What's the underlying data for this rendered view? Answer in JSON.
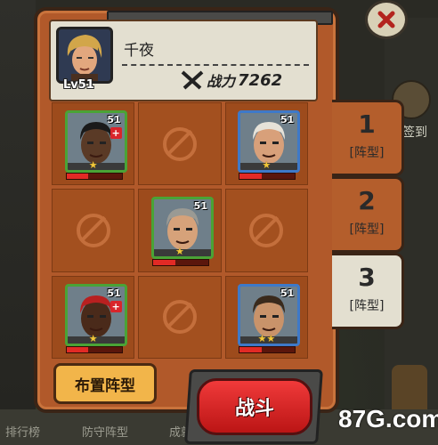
{
  "player": {
    "name": "千夜",
    "level": "Lv51",
    "power_label": "战力",
    "power_value": "7262"
  },
  "grid": [
    {
      "slot": 1,
      "hero": {
        "level": "51",
        "frame": "green",
        "stars": "★",
        "medic": true,
        "skin": "#5a3a26",
        "hair": "#1a1a1a",
        "hp": 0.4
      }
    },
    {
      "slot": 2,
      "hero": null
    },
    {
      "slot": 3,
      "hero": {
        "level": "51",
        "frame": "blue",
        "stars": "★",
        "medic": false,
        "skin": "#d8a07a",
        "hair": "#e6e2d8",
        "hp": 0.4
      }
    },
    {
      "slot": 4,
      "hero": null
    },
    {
      "slot": 5,
      "hero": {
        "level": "51",
        "frame": "green",
        "stars": "★",
        "medic": false,
        "skin": "#d6a27a",
        "hair": "#9a9a94",
        "hp": 0.4
      }
    },
    {
      "slot": 6,
      "hero": null
    },
    {
      "slot": 7,
      "hero": {
        "level": "51",
        "frame": "green",
        "stars": "★",
        "medic": true,
        "skin": "#4a2a1a",
        "hair": "#b82020",
        "hp": 0.4
      }
    },
    {
      "slot": 8,
      "hero": null
    },
    {
      "slot": 9,
      "hero": {
        "level": "51",
        "frame": "blue",
        "stars": "★★",
        "medic": false,
        "skin": "#c9936a",
        "hair": "#3a2a1c",
        "hp": 0.4
      }
    }
  ],
  "formation_tabs": [
    {
      "number": "1",
      "label": "[阵型]",
      "active": false
    },
    {
      "number": "2",
      "label": "[阵型]",
      "active": false
    },
    {
      "number": "3",
      "label": "[阵型]",
      "active": true
    }
  ],
  "buttons": {
    "arrange": "布置阵型",
    "fight": "战斗"
  },
  "background": {
    "sign_in": "签到",
    "tabs": [
      "排行榜",
      "防守阵型",
      "成就"
    ]
  },
  "watermark": "87G.com",
  "colors": {
    "panel": "#b1592a",
    "hp": "#e22a25",
    "fight": "#e02828",
    "frame_green": "#4aa336",
    "frame_blue": "#3e79c8"
  }
}
